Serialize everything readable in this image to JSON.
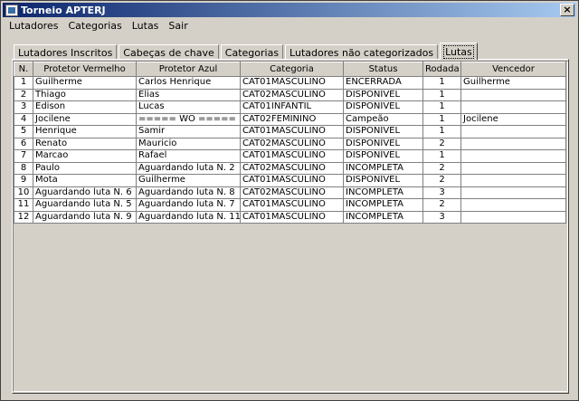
{
  "window": {
    "title": "Torneio APTERJ",
    "close_glyph": "×"
  },
  "menu": [
    "Lutadores",
    "Categorias",
    "Lutas",
    "Sair"
  ],
  "tabs": [
    {
      "label": "Lutadores Inscritos",
      "active": false
    },
    {
      "label": "Cabeças de chave",
      "active": false
    },
    {
      "label": "Categorias",
      "active": false
    },
    {
      "label": "Lutadores não categorizados",
      "active": false
    },
    {
      "label": "Lutas",
      "active": true
    }
  ],
  "table": {
    "columns": [
      "N.",
      "Protetor Vermelho",
      "Protetor Azul",
      "Categoria",
      "Status",
      "Rodada",
      "Vencedor"
    ],
    "rows": [
      [
        "1",
        "Guilherme",
        "Carlos Henrique",
        "CAT01MASCULINO",
        "ENCERRADA",
        "1",
        "Guilherme"
      ],
      [
        "2",
        "Thiago",
        "Elias",
        "CAT02MASCULINO",
        "DISPONÍVEL",
        "1",
        ""
      ],
      [
        "3",
        "Edison",
        "Lucas",
        "CAT01INFANTIL",
        "DISPONÍVEL",
        "1",
        ""
      ],
      [
        "4",
        "Jocilene",
        "===== WO =====",
        "CAT02FEMININO",
        "Campeão",
        "1",
        "Jocilene"
      ],
      [
        "5",
        "Henrique",
        "Samir",
        "CAT01MASCULINO",
        "DISPONÍVEL",
        "1",
        ""
      ],
      [
        "6",
        "Renato",
        "Mauricio",
        "CAT02MASCULINO",
        "DISPONÍVEL",
        "2",
        ""
      ],
      [
        "7",
        "Marcao",
        "Rafael",
        "CAT01MASCULINO",
        "DISPONÍVEL",
        "1",
        ""
      ],
      [
        "8",
        "Paulo",
        "Aguardando luta N. 2",
        "CAT02MASCULINO",
        "INCOMPLETA",
        "2",
        ""
      ],
      [
        "9",
        "Mota",
        "Guilherme",
        "CAT01MASCULINO",
        "DISPONÍVEL",
        "2",
        ""
      ],
      [
        "10",
        "Aguardando luta N. 6",
        "Aguardando luta N. 8",
        "CAT02MASCULINO",
        "INCOMPLETA",
        "3",
        ""
      ],
      [
        "11",
        "Aguardando luta N. 5",
        "Aguardando luta N. 7",
        "CAT01MASCULINO",
        "INCOMPLETA",
        "2",
        ""
      ],
      [
        "12",
        "Aguardando luta N. 9",
        "Aguardando luta N. 11",
        "CAT01MASCULINO",
        "INCOMPLETA",
        "3",
        ""
      ]
    ]
  }
}
